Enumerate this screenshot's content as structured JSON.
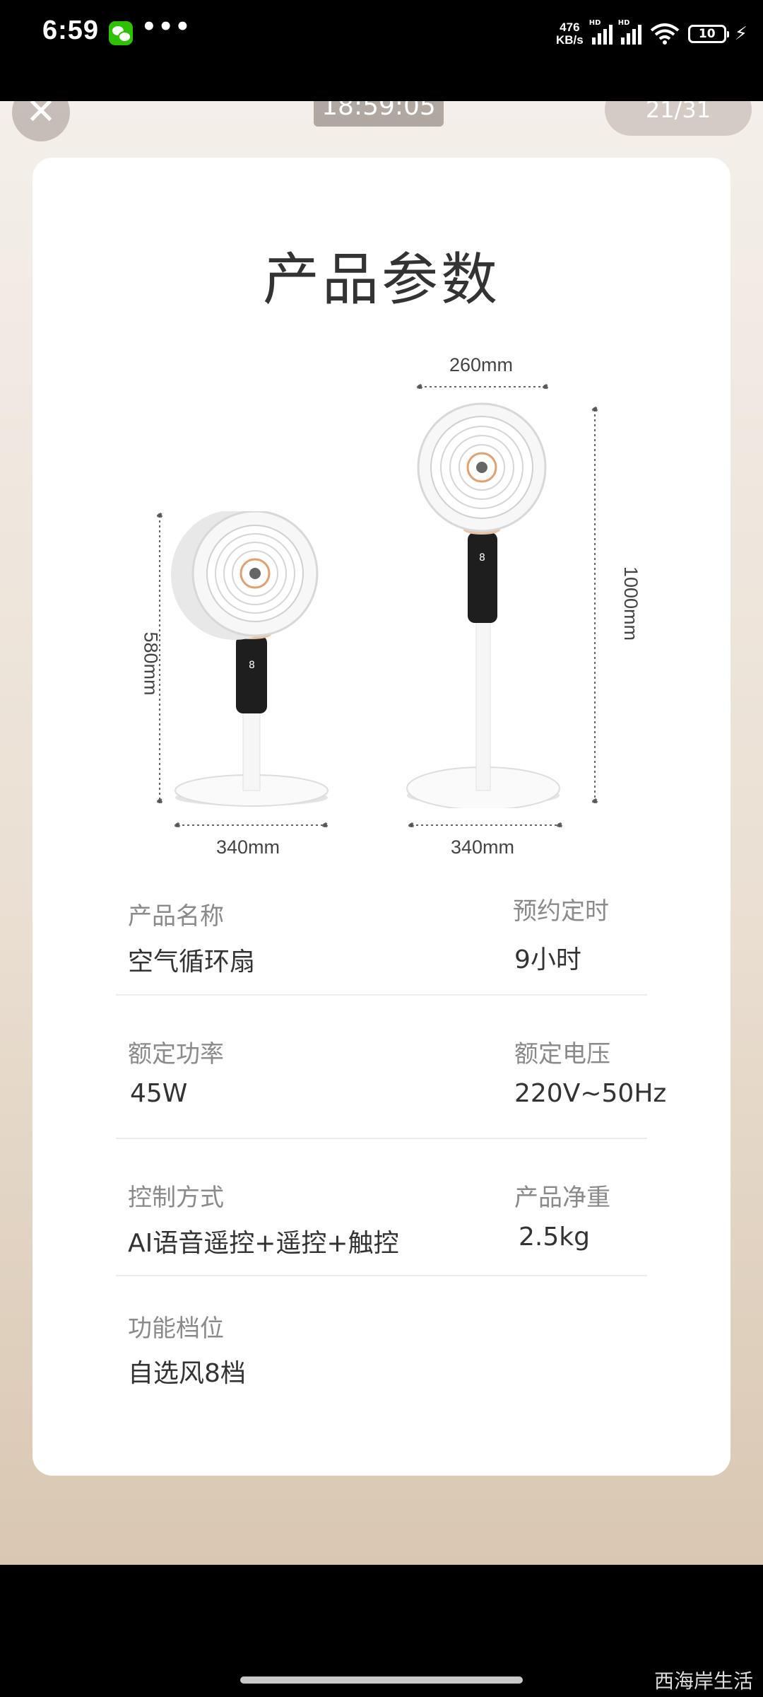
{
  "status_bar": {
    "time": "6:59",
    "more": "•••",
    "net_speed_top": "476",
    "net_speed_unit": "KB/s",
    "hd1": "HD",
    "hd2": "HD",
    "battery": "10"
  },
  "viewer": {
    "close_glyph": "✕",
    "timestamp": "18:59:05",
    "page_counter": "21/31"
  },
  "card": {
    "title": "产品参数",
    "dimensions": {
      "small_height": "580mm",
      "small_width": "340mm",
      "large_top_width": "260mm",
      "large_height": "1000mm",
      "large_width": "340mm"
    },
    "specs": [
      {
        "label": "产品名称",
        "value": "空气循环扇"
      },
      {
        "label": "预约定时",
        "value": "9小时"
      },
      {
        "label": "额定功率",
        "value": "45W"
      },
      {
        "label": "额定电压",
        "value": "220V~50Hz"
      },
      {
        "label": "控制方式",
        "value": "AI语音遥控+遥控+触控"
      },
      {
        "label": "产品净重",
        "value": "2.5kg"
      },
      {
        "label": "功能档位",
        "value": "自选风8档"
      }
    ]
  },
  "watermark": "西海岸生活"
}
